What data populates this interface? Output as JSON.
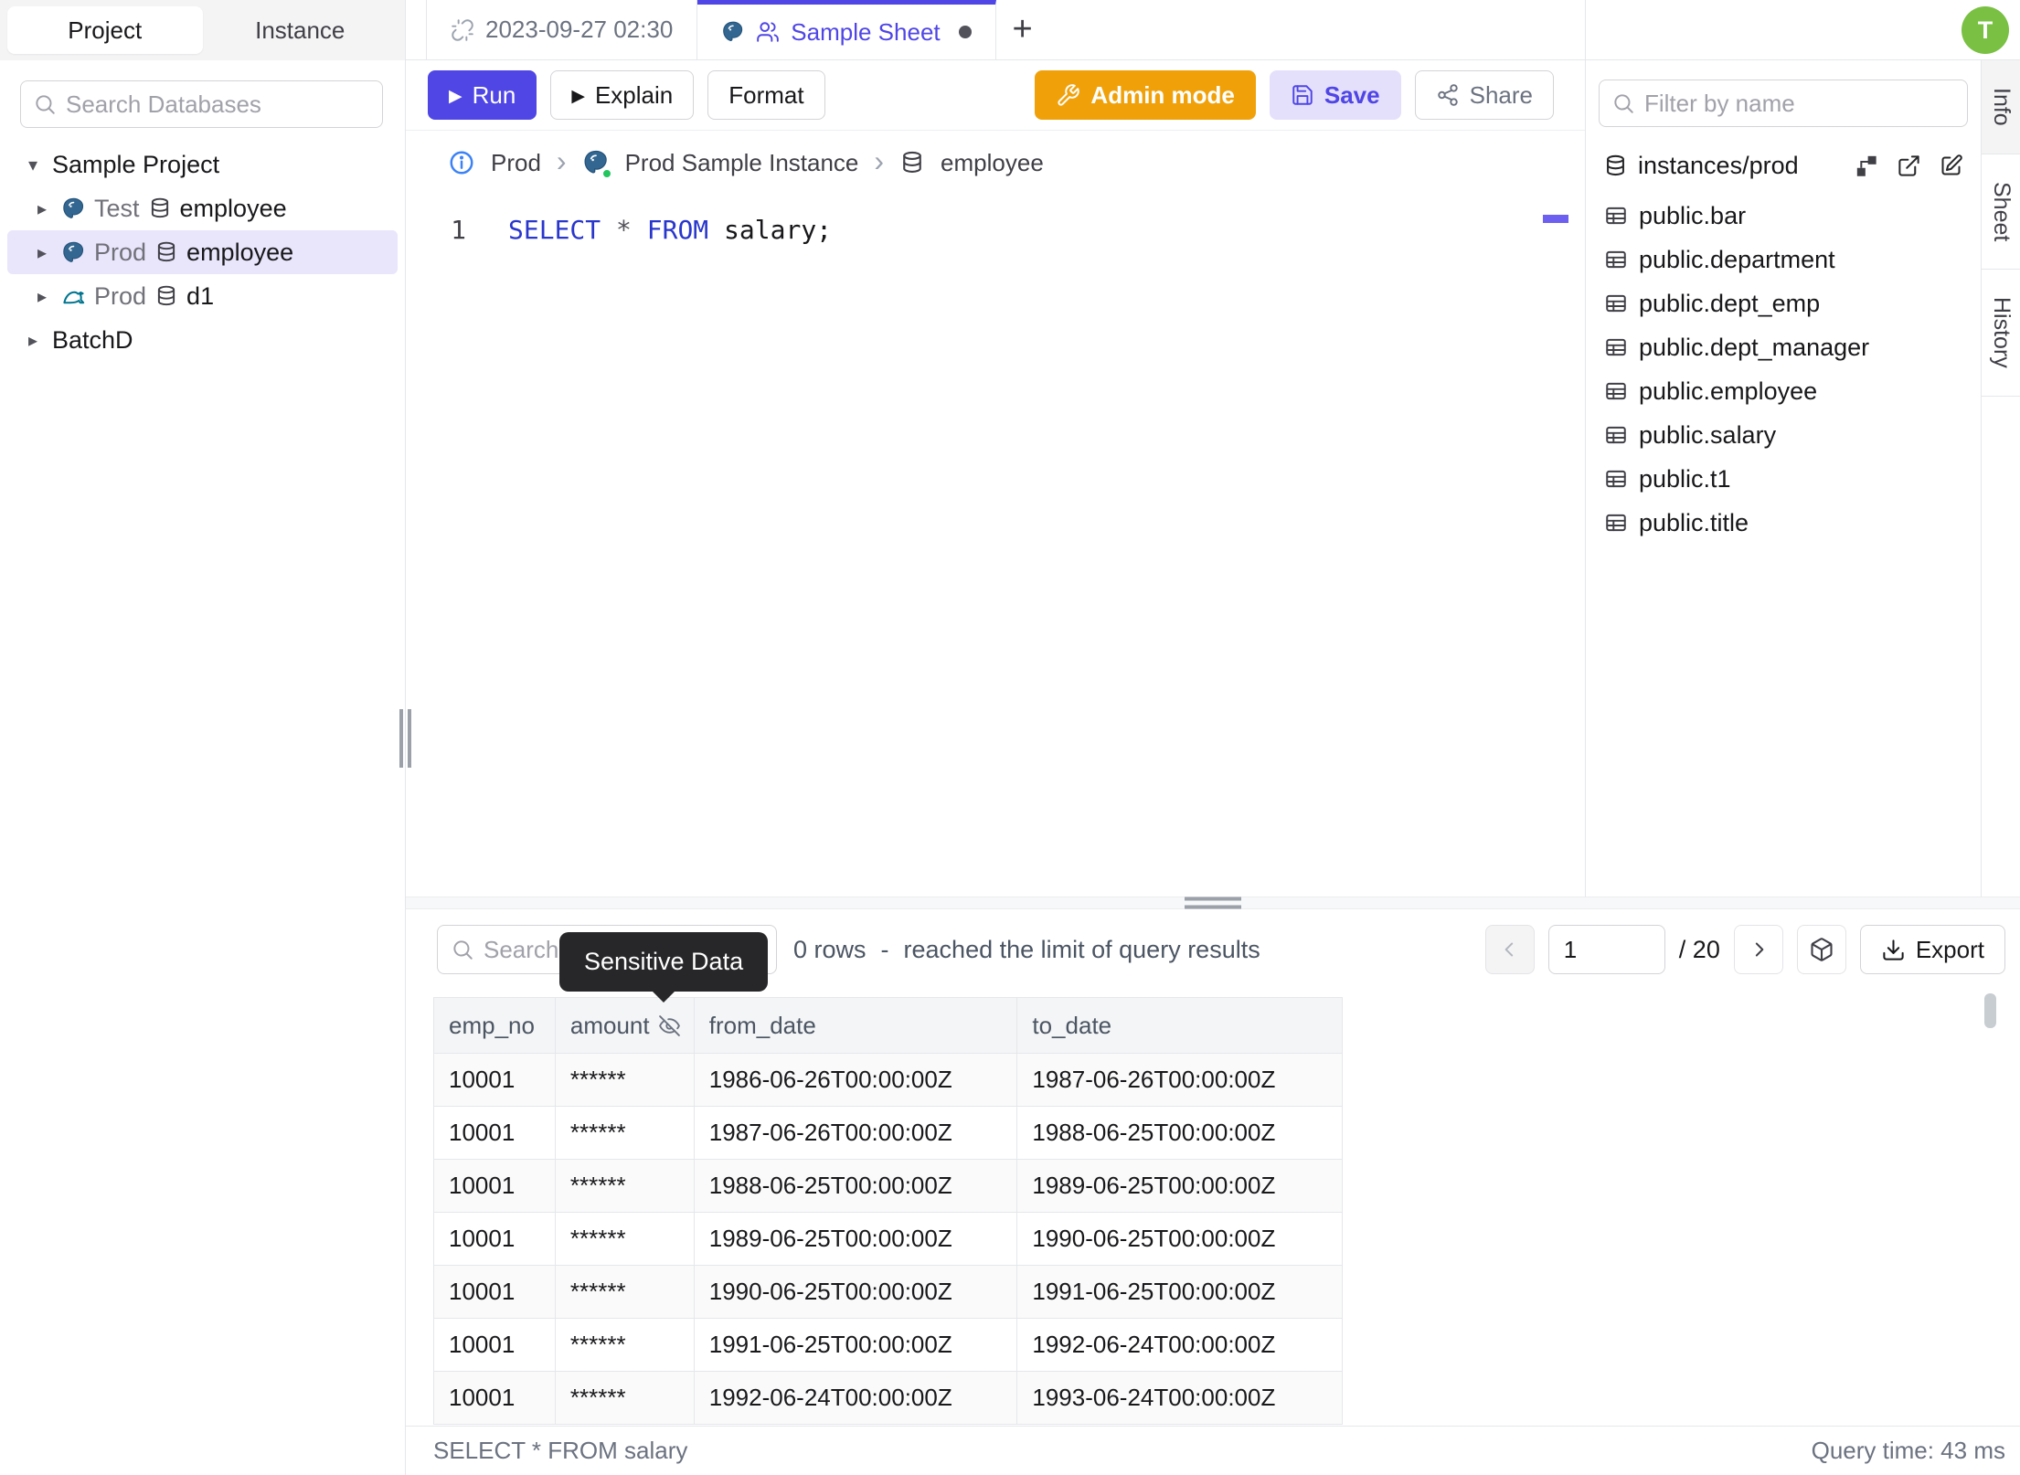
{
  "colors": {
    "accent": "#4f46e5",
    "admin_orange": "#f0a10a",
    "avatar_green": "#79c043",
    "selected_row_bg": "#e9e5fb",
    "keyword_blue": "#2936cc",
    "tooltip_bg": "#27272a"
  },
  "header": {
    "avatar_initial": "T"
  },
  "sidebar": {
    "tabs": [
      {
        "label": "Project",
        "cls": "active"
      },
      {
        "label": "Instance",
        "cls": ""
      }
    ],
    "search_placeholder": "Search Databases",
    "tree": [
      {
        "caret": "▾",
        "label": "Sample Project",
        "cls": "lvl0"
      },
      {
        "caret": "▸",
        "pg": true,
        "env": "Test",
        "db": "employee",
        "cls": "lvl1"
      },
      {
        "caret": "▸",
        "pg": true,
        "env": "Prod",
        "db": "employee",
        "cls": "lvl1 selected"
      },
      {
        "caret": "▸",
        "my": true,
        "env": "Prod",
        "db": "d1",
        "cls": "lvl1"
      },
      {
        "caret": "▸",
        "label": "BatchD",
        "cls": "lvl0"
      }
    ]
  },
  "tabstrip": {
    "sheet_tab_1": "2023-09-27 02:30",
    "sheet_tab_2": "Sample Sheet",
    "new_tab": "+"
  },
  "toolbar": {
    "play": "▶",
    "run": "Run",
    "explain": "Explain",
    "format": "Format",
    "admin_mode": "Admin mode",
    "save": "Save",
    "share": "Share"
  },
  "breadcrumb": {
    "environment": "Prod",
    "separator": "›",
    "instance": "Prod Sample Instance",
    "database": "employee"
  },
  "editor": {
    "line_number": "1",
    "kw_select": "SELECT",
    "star": "*",
    "kw_from": "FROM",
    "rest": "salary;"
  },
  "schema_panel": {
    "filter_placeholder": "Filter by name",
    "connection": "instances/prod",
    "tables": [
      "public.bar",
      "public.department",
      "public.dept_emp",
      "public.dept_manager",
      "public.employee",
      "public.salary",
      "public.t1",
      "public.title"
    ]
  },
  "side_rail": {
    "tabs": [
      {
        "label": "Info",
        "cls": "active"
      },
      {
        "label": "Sheet",
        "cls": ""
      },
      {
        "label": "History",
        "cls": ""
      }
    ]
  },
  "results": {
    "search_placeholder": "Search",
    "tooltip": "Sensitive Data",
    "row_count": "0 rows",
    "separator": "-",
    "limit_note": "reached the limit of query results",
    "page_value": "1",
    "page_total": "/ 20",
    "export_label": "Export",
    "columns": {
      "c1": "emp_no",
      "c2": "amount",
      "c3": "from_date",
      "c4": "to_date"
    },
    "rows": [
      [
        "10001",
        "******",
        "1986-06-26T00:00:00Z",
        "1987-06-26T00:00:00Z"
      ],
      [
        "10001",
        "******",
        "1987-06-26T00:00:00Z",
        "1988-06-25T00:00:00Z"
      ],
      [
        "10001",
        "******",
        "1988-06-25T00:00:00Z",
        "1989-06-25T00:00:00Z"
      ],
      [
        "10001",
        "******",
        "1989-06-25T00:00:00Z",
        "1990-06-25T00:00:00Z"
      ],
      [
        "10001",
        "******",
        "1990-06-25T00:00:00Z",
        "1991-06-25T00:00:00Z"
      ],
      [
        "10001",
        "******",
        "1991-06-25T00:00:00Z",
        "1992-06-24T00:00:00Z"
      ],
      [
        "10001",
        "******",
        "1992-06-24T00:00:00Z",
        "1993-06-24T00:00:00Z"
      ]
    ],
    "status_query": "SELECT * FROM salary",
    "status_time": "Query time: 43 ms"
  }
}
